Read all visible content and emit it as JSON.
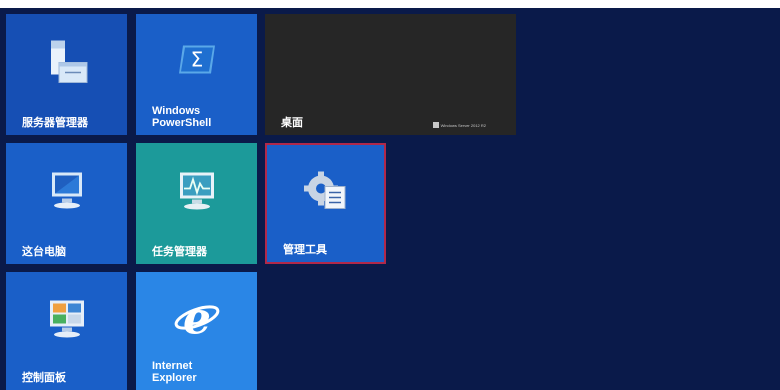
{
  "tiles": {
    "server_manager": {
      "label": "服务器管理器",
      "icon": "server-manager-icon"
    },
    "powershell": {
      "label": "Windows\nPowerShell",
      "icon": "powershell-icon"
    },
    "desktop": {
      "label": "桌面",
      "brand": "Windows Server 2012 R2",
      "icon": "windows-logo-icon"
    },
    "this_pc": {
      "label": "这台电脑",
      "icon": "computer-icon"
    },
    "task_manager": {
      "label": "任务管理器",
      "icon": "task-manager-icon"
    },
    "admin_tools": {
      "label": "管理工具",
      "icon": "administrative-tools-icon"
    },
    "control_panel": {
      "label": "控制面板",
      "icon": "control-panel-icon"
    },
    "internet_explorer": {
      "label": "Internet\nExplorer",
      "icon": "internet-explorer-icon"
    }
  },
  "colors": {
    "background": "#0a1a4a",
    "tile_blue": "#1a5fc8",
    "tile_teal": "#1c9a9a",
    "tile_desktop": "#262626",
    "selection_border": "#b0284a"
  }
}
